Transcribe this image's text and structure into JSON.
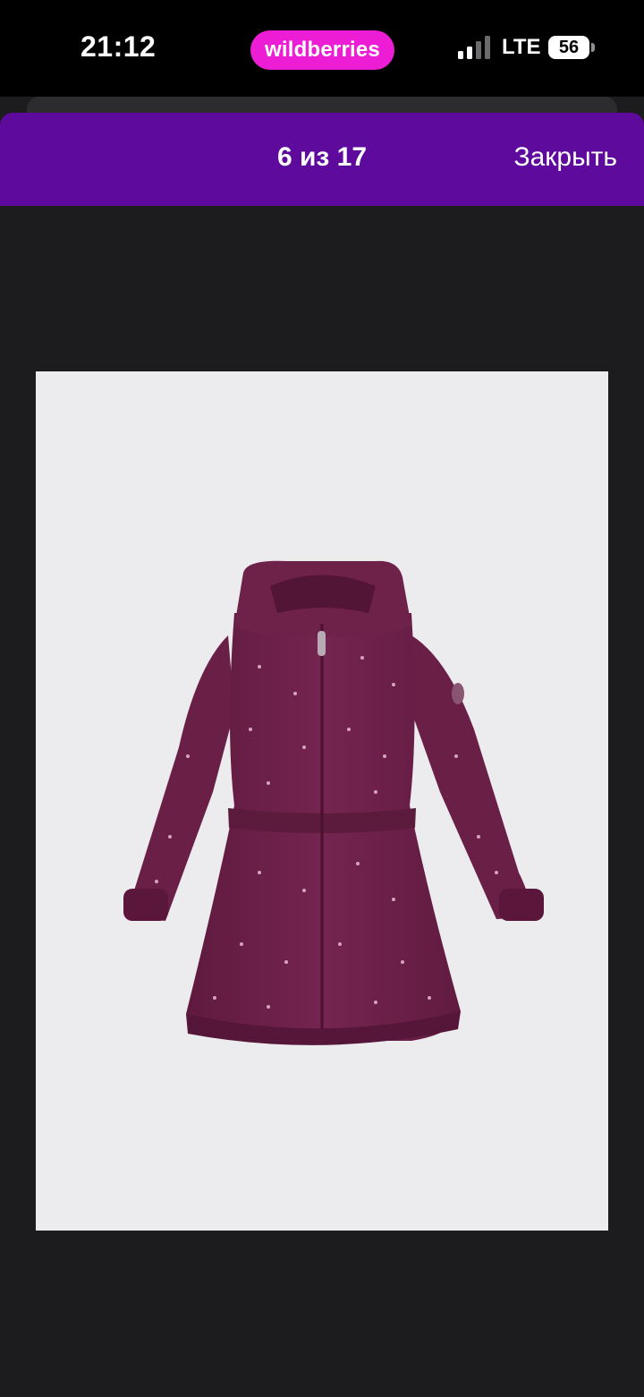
{
  "status_bar": {
    "time": "21:12",
    "brand": "wildberries",
    "network": "LTE",
    "battery": "56",
    "brand_color": "#ec1dd4"
  },
  "viewer": {
    "counter": "6 из 17",
    "close_label": "Закрыть",
    "header_color": "#5e0a9c",
    "photo": {
      "subject": "plum winter jacket with hood",
      "icon": "product-photo-icon"
    }
  }
}
